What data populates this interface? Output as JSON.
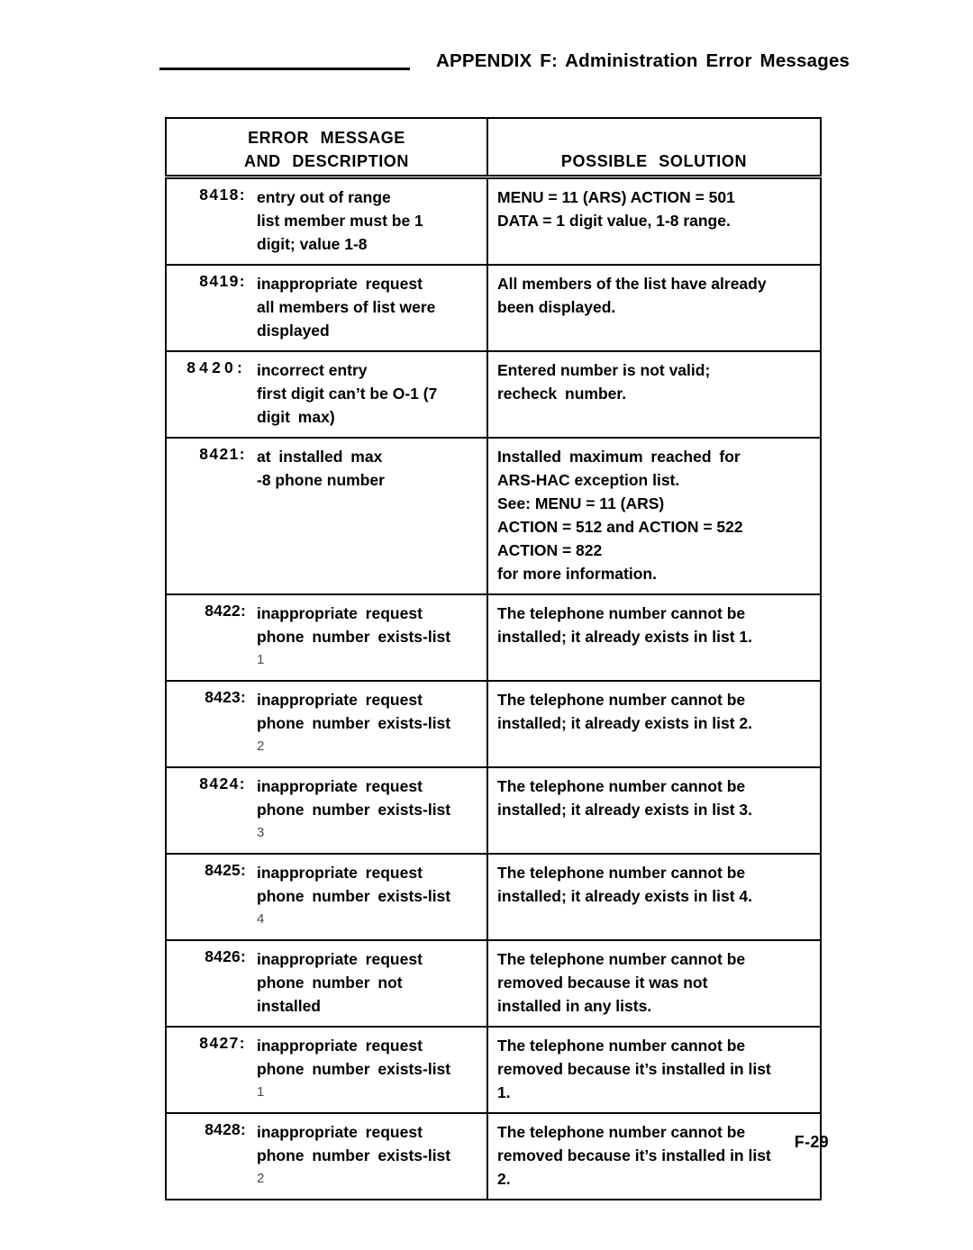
{
  "header": {
    "title": "APPENDIX F: Administration Error Messages"
  },
  "table": {
    "columns": {
      "col1_line1": "ERROR MESSAGE",
      "col1_line2": "AND DESCRIPTION",
      "col2_line1": "POSSIBLE SOLUTION"
    },
    "rows": [
      {
        "code": "8418:",
        "code_spacing": "ls1",
        "description": [
          {
            "text": "entry out of range",
            "style": "normal"
          },
          {
            "text": "list member must be 1",
            "style": "normal"
          },
          {
            "text": "digit; value 1-8",
            "style": "normal"
          }
        ],
        "solution": [
          {
            "text": "MENU = 11 (ARS) ACTION = 501",
            "style": "normal"
          },
          {
            "text": "DATA = 1 digit value, 1-8 range.",
            "style": "normal"
          }
        ]
      },
      {
        "code": "8419:",
        "code_spacing": "ls1",
        "description": [
          {
            "text": "inappropriate request",
            "style": "spaced"
          },
          {
            "text": "all members of list were",
            "style": "normal"
          },
          {
            "text": "displayed",
            "style": "spaced"
          }
        ],
        "solution": [
          {
            "text": "All members of the list have already",
            "style": "normal"
          },
          {
            "text": "been displayed.",
            "style": "normal"
          }
        ]
      },
      {
        "code": "8420:",
        "code_spacing": "ls2",
        "description": [
          {
            "text": "incorrect entry",
            "style": "normal"
          },
          {
            "text": "first digit can’t be O-1 (7",
            "style": "normal"
          },
          {
            "text": "digit max)",
            "style": "spaced"
          }
        ],
        "solution": [
          {
            "text": "Entered number is not valid;",
            "style": "normal"
          },
          {
            "text": "recheck number.",
            "style": "spaced"
          }
        ]
      },
      {
        "code": "8421:",
        "code_spacing": "ls1",
        "description": [
          {
            "text": "at installed max",
            "style": "spaced"
          },
          {
            "text": "-8 phone number",
            "style": "normal"
          }
        ],
        "solution": [
          {
            "text": "Installed maximum reached for",
            "style": "spaced"
          },
          {
            "text": "ARS-HAC exception list.",
            "style": "normal"
          },
          {
            "text": "See: MENU = 11 (ARS)",
            "style": "normal"
          },
          {
            "text": "ACTION = 512 and ACTION = 522",
            "style": "normal"
          },
          {
            "text": "ACTION = 822",
            "style": "normal"
          },
          {
            "text": "for more information.",
            "style": "normal"
          }
        ]
      },
      {
        "code": "8422:",
        "code_spacing": "ls0",
        "description": [
          {
            "text": "inappropriate request",
            "style": "spaced"
          },
          {
            "text": "phone number exists-list",
            "style": "spaced"
          },
          {
            "text": "1",
            "style": "thin"
          }
        ],
        "solution": [
          {
            "text": "The telephone number cannot be",
            "style": "normal"
          },
          {
            "text": "installed; it already exists in list 1.",
            "style": "normal"
          }
        ]
      },
      {
        "code": "8423:",
        "code_spacing": "ls0",
        "description": [
          {
            "text": "inappropriate request",
            "style": "spaced"
          },
          {
            "text": "phone number exists-list",
            "style": "spaced"
          },
          {
            "text": "2",
            "style": "thin"
          }
        ],
        "solution": [
          {
            "text": "The telephone number cannot be",
            "style": "normal"
          },
          {
            "text": "installed; it already exists in list 2.",
            "style": "normal"
          }
        ]
      },
      {
        "code": "8424:",
        "code_spacing": "ls1",
        "description": [
          {
            "text": "inappropriate request",
            "style": "spaced"
          },
          {
            "text": "phone number exists-list",
            "style": "spaced"
          },
          {
            "text": "3",
            "style": "thin"
          }
        ],
        "solution": [
          {
            "text": "The telephone number cannot be",
            "style": "normal"
          },
          {
            "text": "installed; it already exists in list 3.",
            "style": "normal"
          }
        ]
      },
      {
        "code": "8425:",
        "code_spacing": "ls0",
        "description": [
          {
            "text": "inappropriate request",
            "style": "spaced"
          },
          {
            "text": "phone number exists-list",
            "style": "spaced"
          },
          {
            "text": "4",
            "style": "thin"
          }
        ],
        "solution": [
          {
            "text": "The telephone number cannot be",
            "style": "normal"
          },
          {
            "text": "installed; it already exists in list 4.",
            "style": "normal"
          }
        ]
      },
      {
        "code": "8426:",
        "code_spacing": "ls0",
        "description": [
          {
            "text": "inappropriate request",
            "style": "spaced"
          },
          {
            "text": "phone number not",
            "style": "spaced"
          },
          {
            "text": "installed",
            "style": "normal"
          }
        ],
        "solution": [
          {
            "text": "The telephone number cannot be",
            "style": "normal"
          },
          {
            "text": "removed because it was not",
            "style": "normal"
          },
          {
            "text": "installed in any lists.",
            "style": "normal"
          }
        ]
      },
      {
        "code": "8427:",
        "code_spacing": "ls1",
        "description": [
          {
            "text": "inappropriate request",
            "style": "spaced"
          },
          {
            "text": "phone number exists-list",
            "style": "spaced"
          },
          {
            "text": "1",
            "style": "thin"
          }
        ],
        "solution": [
          {
            "text": "The telephone number cannot be",
            "style": "normal"
          },
          {
            "text": "removed because it’s installed in list",
            "style": "normal"
          },
          {
            "text": "1.",
            "style": "normal"
          }
        ]
      },
      {
        "code": "8428:",
        "code_spacing": "ls0",
        "description": [
          {
            "text": "inappropriate request",
            "style": "spaced"
          },
          {
            "text": "phone number exists-list",
            "style": "spaced"
          },
          {
            "text": "2",
            "style": "thin"
          }
        ],
        "solution": [
          {
            "text": "The telephone number cannot be",
            "style": "normal"
          },
          {
            "text": "removed because it’s installed in list",
            "style": "normal"
          },
          {
            "text": "2.",
            "style": "normal"
          }
        ]
      }
    ]
  },
  "footer": {
    "page_number": "F-29"
  }
}
